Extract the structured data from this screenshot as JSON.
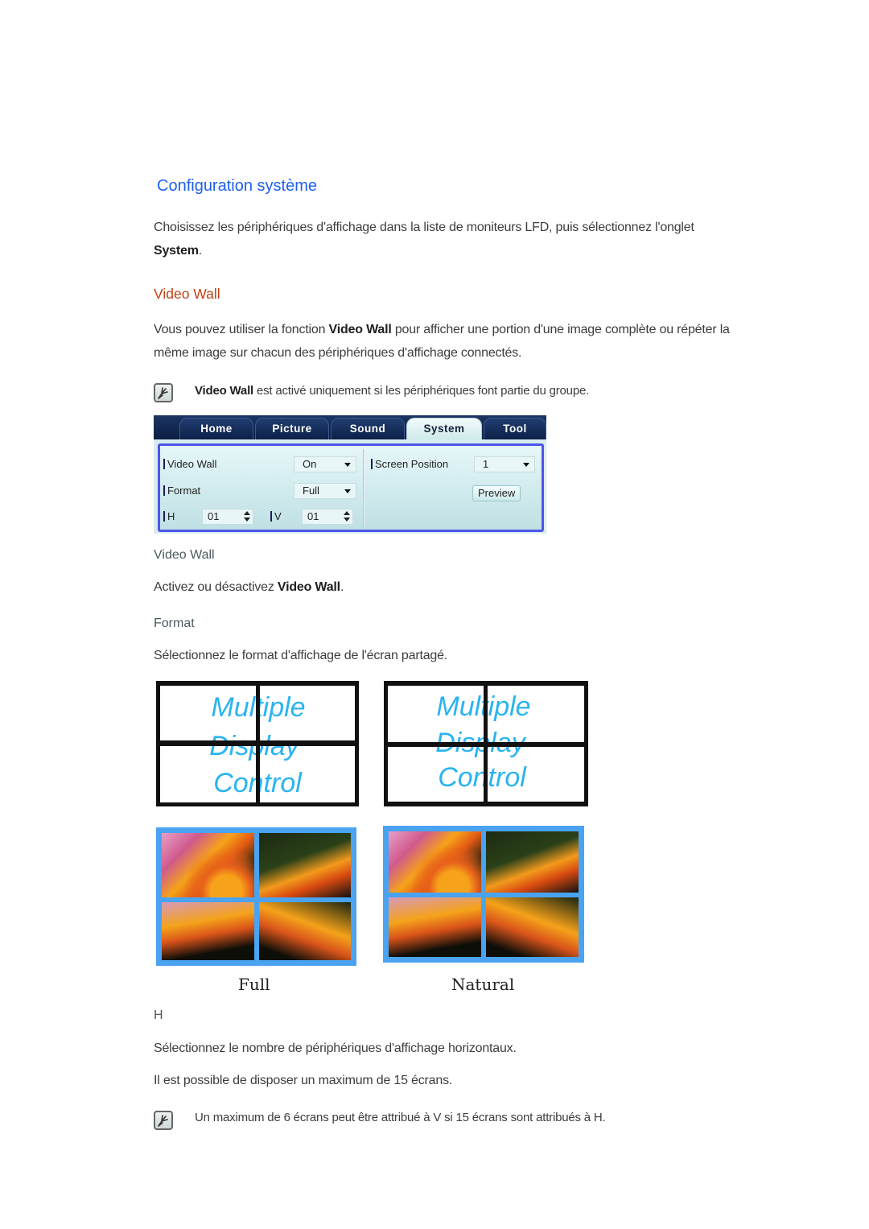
{
  "heading": "Configuration système",
  "intro": {
    "text": "Choisissez les périphériques d'affichage dans la liste de moniteurs LFD, puis sélectionnez l'onglet",
    "bold": "System",
    "end": "."
  },
  "section_title": "Video Wall",
  "section_desc": {
    "pre": "Vous pouvez utiliser la fonction",
    "bold": "Video Wall",
    "post": "pour afficher une portion d'une image complète ou répéter la",
    "line2": "même image sur chacun des périphériques d'affichage connectés."
  },
  "note1": {
    "bold": "Video Wall",
    "text": "est activé uniquement si les périphériques font partie du groupe.",
    "icon": "note-pencil-icon"
  },
  "panel": {
    "tabs": [
      {
        "label": "Home",
        "active": false
      },
      {
        "label": "Picture",
        "active": false
      },
      {
        "label": "Sound",
        "active": false
      },
      {
        "label": "System",
        "active": true
      },
      {
        "label": "Tool",
        "active": false
      }
    ],
    "video_wall": {
      "label": "Video Wall",
      "value": "On"
    },
    "format": {
      "label": "Format",
      "value": "Full"
    },
    "h": {
      "label": "H",
      "value": "01"
    },
    "v": {
      "label": "V",
      "value": "01"
    },
    "screen_position": {
      "label": "Screen Position",
      "value": "1"
    },
    "preview_label": "Preview"
  },
  "item_video_wall": {
    "title": "Video Wall",
    "pre": "Activez ou désactivez",
    "bold": "Video Wall",
    "end": "."
  },
  "item_format": {
    "title": "Format",
    "desc": "Sélectionnez le format d'affichage de l'écran partagé."
  },
  "illustration": {
    "mdc_text": [
      "Multiple",
      "Display",
      "Control"
    ],
    "text_color": "#2ab4f0",
    "frame_color": "#4aa3f0",
    "captions": [
      "Full",
      "Natural"
    ]
  },
  "item_h": {
    "title": "H",
    "desc1": "Sélectionnez le nombre de périphériques d'affichage horizontaux.",
    "desc2": "Il est possible de disposer un maximum de 15 écrans."
  },
  "note2": {
    "text": "Un maximum de 6 écrans peut être attribué à V si 15 écrans sont attribués à H.",
    "icon": "note-pencil-icon"
  }
}
